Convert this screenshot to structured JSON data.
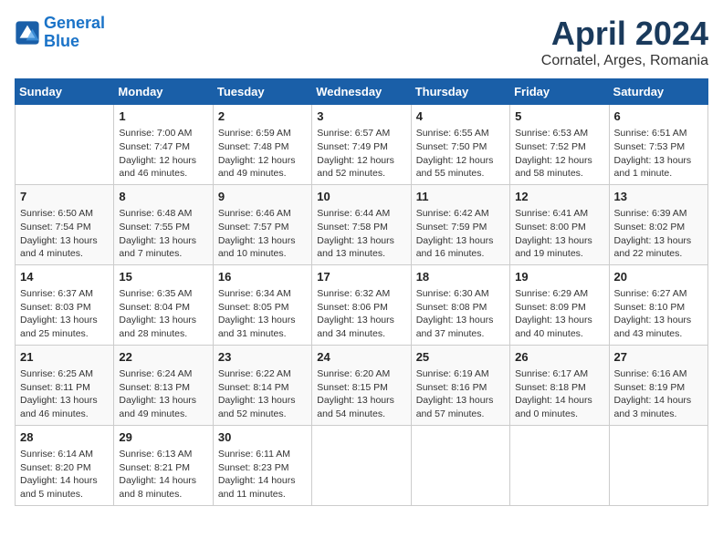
{
  "logo": {
    "line1": "General",
    "line2": "Blue"
  },
  "title": "April 2024",
  "subtitle": "Cornatel, Arges, Romania",
  "weekdays": [
    "Sunday",
    "Monday",
    "Tuesday",
    "Wednesday",
    "Thursday",
    "Friday",
    "Saturday"
  ],
  "weeks": [
    [
      {
        "day": "",
        "content": ""
      },
      {
        "day": "1",
        "content": "Sunrise: 7:00 AM\nSunset: 7:47 PM\nDaylight: 12 hours\nand 46 minutes."
      },
      {
        "day": "2",
        "content": "Sunrise: 6:59 AM\nSunset: 7:48 PM\nDaylight: 12 hours\nand 49 minutes."
      },
      {
        "day": "3",
        "content": "Sunrise: 6:57 AM\nSunset: 7:49 PM\nDaylight: 12 hours\nand 52 minutes."
      },
      {
        "day": "4",
        "content": "Sunrise: 6:55 AM\nSunset: 7:50 PM\nDaylight: 12 hours\nand 55 minutes."
      },
      {
        "day": "5",
        "content": "Sunrise: 6:53 AM\nSunset: 7:52 PM\nDaylight: 12 hours\nand 58 minutes."
      },
      {
        "day": "6",
        "content": "Sunrise: 6:51 AM\nSunset: 7:53 PM\nDaylight: 13 hours\nand 1 minute."
      }
    ],
    [
      {
        "day": "7",
        "content": "Sunrise: 6:50 AM\nSunset: 7:54 PM\nDaylight: 13 hours\nand 4 minutes."
      },
      {
        "day": "8",
        "content": "Sunrise: 6:48 AM\nSunset: 7:55 PM\nDaylight: 13 hours\nand 7 minutes."
      },
      {
        "day": "9",
        "content": "Sunrise: 6:46 AM\nSunset: 7:57 PM\nDaylight: 13 hours\nand 10 minutes."
      },
      {
        "day": "10",
        "content": "Sunrise: 6:44 AM\nSunset: 7:58 PM\nDaylight: 13 hours\nand 13 minutes."
      },
      {
        "day": "11",
        "content": "Sunrise: 6:42 AM\nSunset: 7:59 PM\nDaylight: 13 hours\nand 16 minutes."
      },
      {
        "day": "12",
        "content": "Sunrise: 6:41 AM\nSunset: 8:00 PM\nDaylight: 13 hours\nand 19 minutes."
      },
      {
        "day": "13",
        "content": "Sunrise: 6:39 AM\nSunset: 8:02 PM\nDaylight: 13 hours\nand 22 minutes."
      }
    ],
    [
      {
        "day": "14",
        "content": "Sunrise: 6:37 AM\nSunset: 8:03 PM\nDaylight: 13 hours\nand 25 minutes."
      },
      {
        "day": "15",
        "content": "Sunrise: 6:35 AM\nSunset: 8:04 PM\nDaylight: 13 hours\nand 28 minutes."
      },
      {
        "day": "16",
        "content": "Sunrise: 6:34 AM\nSunset: 8:05 PM\nDaylight: 13 hours\nand 31 minutes."
      },
      {
        "day": "17",
        "content": "Sunrise: 6:32 AM\nSunset: 8:06 PM\nDaylight: 13 hours\nand 34 minutes."
      },
      {
        "day": "18",
        "content": "Sunrise: 6:30 AM\nSunset: 8:08 PM\nDaylight: 13 hours\nand 37 minutes."
      },
      {
        "day": "19",
        "content": "Sunrise: 6:29 AM\nSunset: 8:09 PM\nDaylight: 13 hours\nand 40 minutes."
      },
      {
        "day": "20",
        "content": "Sunrise: 6:27 AM\nSunset: 8:10 PM\nDaylight: 13 hours\nand 43 minutes."
      }
    ],
    [
      {
        "day": "21",
        "content": "Sunrise: 6:25 AM\nSunset: 8:11 PM\nDaylight: 13 hours\nand 46 minutes."
      },
      {
        "day": "22",
        "content": "Sunrise: 6:24 AM\nSunset: 8:13 PM\nDaylight: 13 hours\nand 49 minutes."
      },
      {
        "day": "23",
        "content": "Sunrise: 6:22 AM\nSunset: 8:14 PM\nDaylight: 13 hours\nand 52 minutes."
      },
      {
        "day": "24",
        "content": "Sunrise: 6:20 AM\nSunset: 8:15 PM\nDaylight: 13 hours\nand 54 minutes."
      },
      {
        "day": "25",
        "content": "Sunrise: 6:19 AM\nSunset: 8:16 PM\nDaylight: 13 hours\nand 57 minutes."
      },
      {
        "day": "26",
        "content": "Sunrise: 6:17 AM\nSunset: 8:18 PM\nDaylight: 14 hours\nand 0 minutes."
      },
      {
        "day": "27",
        "content": "Sunrise: 6:16 AM\nSunset: 8:19 PM\nDaylight: 14 hours\nand 3 minutes."
      }
    ],
    [
      {
        "day": "28",
        "content": "Sunrise: 6:14 AM\nSunset: 8:20 PM\nDaylight: 14 hours\nand 5 minutes."
      },
      {
        "day": "29",
        "content": "Sunrise: 6:13 AM\nSunset: 8:21 PM\nDaylight: 14 hours\nand 8 minutes."
      },
      {
        "day": "30",
        "content": "Sunrise: 6:11 AM\nSunset: 8:23 PM\nDaylight: 14 hours\nand 11 minutes."
      },
      {
        "day": "",
        "content": ""
      },
      {
        "day": "",
        "content": ""
      },
      {
        "day": "",
        "content": ""
      },
      {
        "day": "",
        "content": ""
      }
    ]
  ]
}
